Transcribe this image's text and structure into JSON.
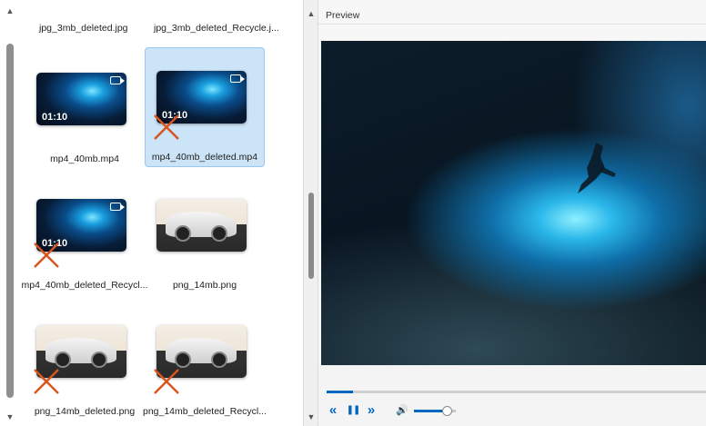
{
  "file_panel": {
    "top_labels": [
      "jpg_3mb_deleted.jpg",
      "jpg_3mb_deleted_Recycle.j..."
    ],
    "tiles": [
      {
        "label": "mp4_40mb.mp4",
        "type": "video",
        "duration": "01:10",
        "deleted": false,
        "selected": false
      },
      {
        "label": "mp4_40mb_deleted.mp4",
        "type": "video",
        "duration": "01:10",
        "deleted": true,
        "selected": true
      },
      {
        "label": "mp4_40mb_deleted_Recycl...",
        "type": "video",
        "duration": "01:10",
        "deleted": true,
        "selected": false
      },
      {
        "label": "png_14mb.png",
        "type": "image",
        "deleted": false,
        "selected": false
      },
      {
        "label": "png_14mb_deleted.png",
        "type": "image",
        "deleted": true,
        "selected": false
      },
      {
        "label": "png_14mb_deleted_Recycl...",
        "type": "image",
        "deleted": true,
        "selected": false
      }
    ]
  },
  "preview": {
    "title": "Preview",
    "progress": 0.07,
    "volume": 0.78
  },
  "icons": {
    "scroll_up": "▲",
    "scroll_down": "▼",
    "rewind": "«",
    "pause": "❚❚",
    "forward": "»",
    "volume": "🔊"
  },
  "colors": {
    "accent": "#0067c0",
    "selected_bg": "#cce4f7",
    "delete_mark": "#d9541e"
  }
}
